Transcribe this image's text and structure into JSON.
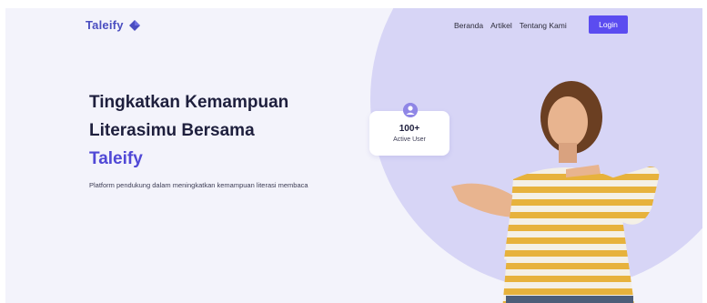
{
  "brand": {
    "name": "Taleify",
    "accent": "#4a4dc0",
    "button_color": "#5b4cf0"
  },
  "nav": {
    "items": [
      "Beranda",
      "Artikel",
      "Tentang Kami"
    ],
    "login_label": "Login"
  },
  "hero": {
    "line1": "Tingkatkan Kemampuan",
    "line2": "Literasimu Bersama",
    "accent": "Taleify",
    "subtitle": "Platform pendukung dalam meningkatkan kemampuan literasi membaca"
  },
  "badge": {
    "count": "100+",
    "label": "Active User",
    "icon": "user-icon"
  },
  "images": {
    "hero_person": "woman-pointing-illustration"
  }
}
